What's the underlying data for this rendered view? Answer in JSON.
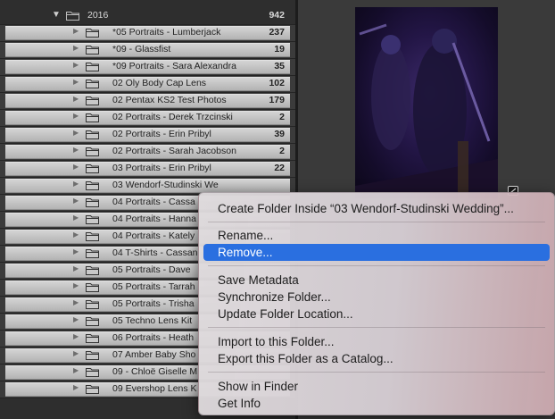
{
  "parent_folder": {
    "name": "2016",
    "count": "942"
  },
  "folders": [
    {
      "name": "*05 Portraits - Lumberjack",
      "count": "237"
    },
    {
      "name": "*09 - Glassfist",
      "count": "19"
    },
    {
      "name": "*09 Portraits - Sara Alexandra",
      "count": "35"
    },
    {
      "name": "02 Oly Body Cap Lens",
      "count": "102"
    },
    {
      "name": "02 Pentax KS2 Test Photos",
      "count": "179"
    },
    {
      "name": "02 Portraits - Derek Trzcinski",
      "count": "2"
    },
    {
      "name": "02 Portraits - Erin Pribyl",
      "count": "39"
    },
    {
      "name": "02 Portraits - Sarah Jacobson",
      "count": "2"
    },
    {
      "name": "03 Portraits - Erin Pribyl",
      "count": "22"
    },
    {
      "name": "03 Wendorf-Studinski We",
      "count": ""
    },
    {
      "name": "04 Portraits - Cassa",
      "count": ""
    },
    {
      "name": "04 Portraits - Hanna",
      "count": ""
    },
    {
      "name": "04 Portraits - Kately",
      "count": ""
    },
    {
      "name": "04 T-Shirts - Cassan",
      "count": ""
    },
    {
      "name": "05 Portraits - Dave",
      "count": ""
    },
    {
      "name": "05 Portraits - Tarrah",
      "count": ""
    },
    {
      "name": "05 Portraits - Trisha",
      "count": ""
    },
    {
      "name": "05 Techno Lens Kit",
      "count": ""
    },
    {
      "name": "06 Portraits - Heath",
      "count": ""
    },
    {
      "name": "07 Amber Baby Sho",
      "count": ""
    },
    {
      "name": "09 - Chloë Giselle M",
      "count": ""
    },
    {
      "name": "09 Evershop Lens K",
      "count": ""
    }
  ],
  "context_menu": {
    "create_folder": "Create Folder Inside “03 Wendorf-Studinski Wedding”...",
    "rename": "Rename...",
    "remove": "Remove...",
    "save_metadata": "Save Metadata",
    "synchronize": "Synchronize Folder...",
    "update_location": "Update Folder Location...",
    "import": "Import to this Folder...",
    "export_catalog": "Export this Folder as a Catalog...",
    "show_in_finder": "Show in Finder",
    "get_info": "Get Info"
  },
  "colors": {
    "highlight": "#2a6fe0",
    "folder_bar": "#c4c4c4",
    "panel_bg": "#2e2e2e"
  },
  "icons": {
    "disclosure_expanded": "triangle-down-icon",
    "disclosure_collapsed": "triangle-right-icon",
    "folder": "folder-icon",
    "badge": "badge-icon"
  }
}
